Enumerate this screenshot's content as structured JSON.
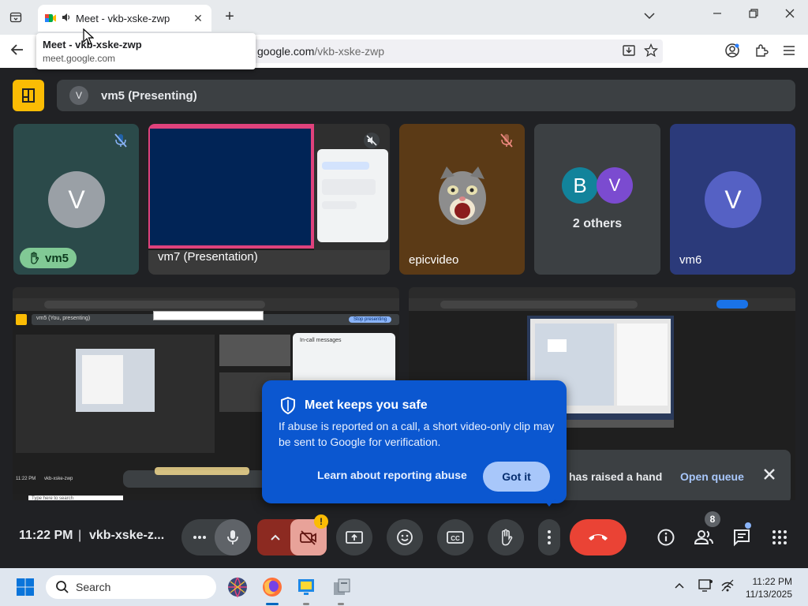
{
  "browser": {
    "tab_title": "Meet - vkb-xske-zwp",
    "tooltip_title": "Meet - vkb-xske-zwp",
    "tooltip_url": "meet.google.com",
    "url_host": "google.com",
    "url_path": "/vkb-xske-zwp",
    "new_tab": "+",
    "close_tab": "✕"
  },
  "meet": {
    "presenting_avatar": "V",
    "presenting_label": "vm5 (Presenting)",
    "tiles": [
      {
        "name": "vm5",
        "avatar": "V",
        "hand_raised": true
      },
      {
        "name": "vm7 (Presentation)"
      },
      {
        "name": "epicvideo"
      },
      {
        "name": "2 others",
        "avatars": [
          "B",
          "V"
        ]
      },
      {
        "name": "vm6",
        "avatar": "V"
      }
    ],
    "mini_screen": {
      "presenting_label": "vm5 (You, presenting)",
      "stop_btn": "Stop presenting",
      "clock": "11:22 PM",
      "code": "vkb-xske-zwp",
      "search": "Type here to search",
      "chat_title": "In-call messages"
    }
  },
  "popup": {
    "title": "Meet keeps you safe",
    "body": "If abuse is reported on a call, a short video-only clip may be sent to Google for verification.",
    "link": "Learn about reporting abuse",
    "button": "Got it"
  },
  "hand_notice": {
    "text": "has raised a hand",
    "action": "Open queue"
  },
  "controls": {
    "time": "11:22 PM",
    "separator": "|",
    "meeting_code": "vkb-xske-z...",
    "people_count": "8",
    "warning": "!"
  },
  "taskbar": {
    "search_label": "Search",
    "time": "11:22 PM",
    "date": "11/13/2025"
  },
  "colors": {
    "meet_bg": "#202124",
    "tile_bg": "#3c4043",
    "accent_yellow": "#fbbc04",
    "end_call_red": "#ea4335",
    "popup_blue": "#0b57d0",
    "hand_green": "#81c995"
  }
}
